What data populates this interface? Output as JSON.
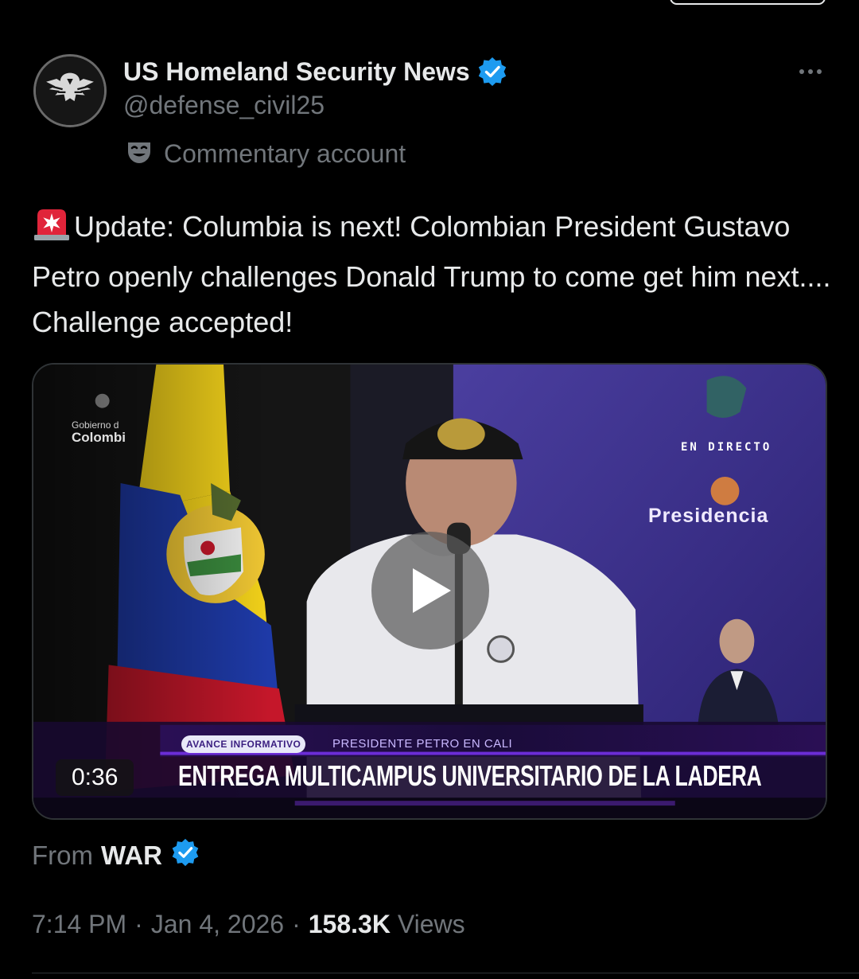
{
  "author": {
    "display_name": "US Homeland Security News",
    "handle": "@defense_civil25",
    "label": "Commentary account",
    "avatar_icon": "eagle-shield-logo",
    "verified": true
  },
  "tweet": {
    "emoji_icon": "police-siren-emoji",
    "text": "Update: Columbia is next! Colombian President Gustavo Petro openly challenges Donald Trump to come get him next.... Challenge accepted!"
  },
  "media": {
    "duration": "0:36",
    "overlay": {
      "gobierno_line1": "Gobierno d",
      "gobierno_line2": "Colombi",
      "en_directo": "EN DIRECTO",
      "presidencia": "Presidencia",
      "avance_pill": "AVANCE INFORMATIVO",
      "lower_sub": "PRESIDENTE PETRO EN CALI",
      "lower_main": "ENTREGA MULTICAMPUS UNIVERSITARIO DE LA LADERA"
    }
  },
  "attribution": {
    "from_label": "From",
    "source_name": "WAR",
    "verified": true
  },
  "meta": {
    "time": "7:14 PM",
    "date": "Jan 4, 2026",
    "separator": "·",
    "views_count": "158.3K",
    "views_label": "Views"
  },
  "colors": {
    "background": "#000000",
    "text_primary": "#e7e9ea",
    "text_secondary": "#71767b",
    "verified_blue": "#1d9bf0",
    "border": "#2f3336"
  }
}
